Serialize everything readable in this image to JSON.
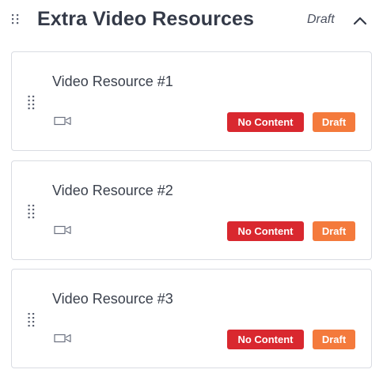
{
  "section": {
    "title": "Extra Video Resources",
    "status": "Draft",
    "drag_icon": "drag-handle-icon",
    "collapse_icon": "chevron-up-icon"
  },
  "items": [
    {
      "title": "Video Resource #1",
      "type_icon": "video-camera-icon",
      "badges": {
        "content": "No Content",
        "status": "Draft"
      }
    },
    {
      "title": "Video Resource #2",
      "type_icon": "video-camera-icon",
      "badges": {
        "content": "No Content",
        "status": "Draft"
      }
    },
    {
      "title": "Video Resource #3",
      "type_icon": "video-camera-icon",
      "badges": {
        "content": "No Content",
        "status": "Draft"
      }
    }
  ],
  "colors": {
    "no_content_badge": "#d9282f",
    "draft_badge": "#f47a3c",
    "card_border": "#d9dce2",
    "title_text": "#343a48"
  }
}
